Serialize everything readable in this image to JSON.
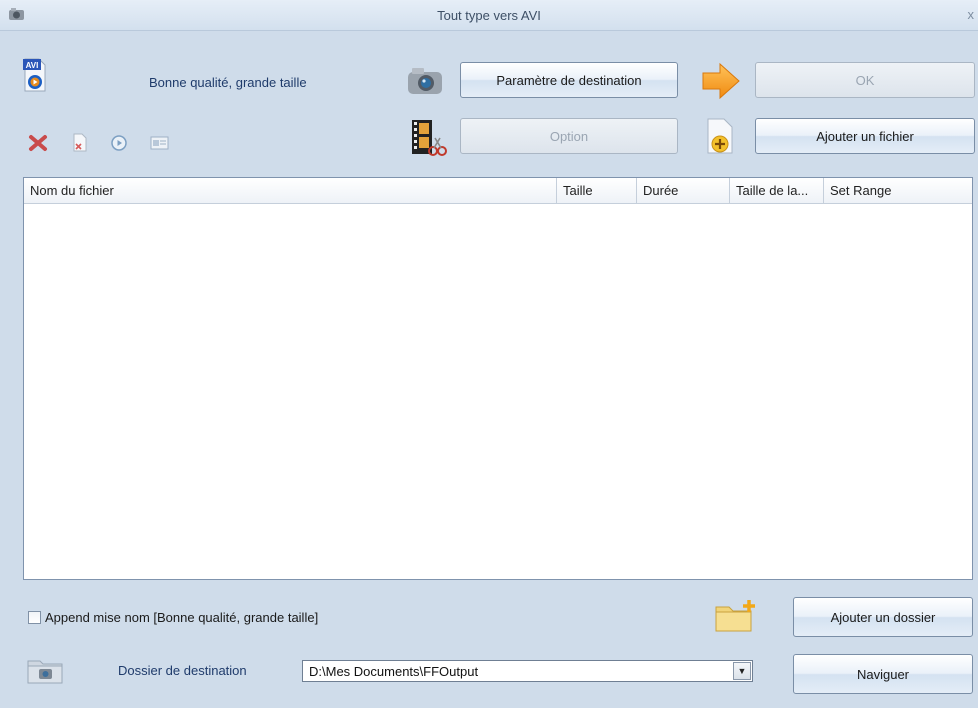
{
  "window": {
    "title": "Tout type vers AVI",
    "close_glyph": "x"
  },
  "profile": {
    "icon": "avi-file-icon",
    "icon_text": "AVI",
    "label": "Bonne qualité, grande taille"
  },
  "toolbar": {
    "settings_icon": "camera-settings-icon",
    "destination_settings_label": "Paramètre de destination",
    "arrow_icon": "right-arrow-icon",
    "ok_label": "OK",
    "clip_icon": "film-scissors-icon",
    "option_label": "Option",
    "add_icon": "add-file-icon",
    "add_file_label": "Ajouter un fichier",
    "mini_icons": [
      "delete-icon",
      "remove-file-icon",
      "play-icon",
      "info-icon"
    ]
  },
  "file_list": {
    "columns": [
      "Nom du fichier",
      "Taille",
      "Durée",
      "Taille de la...",
      "Set Range"
    ],
    "rows": []
  },
  "footer": {
    "append_checkbox_label": "Append mise nom [Bonne qualité, grande taille]",
    "append_checked": false,
    "add_folder_label": "Ajouter un dossier",
    "destination_label": "Dossier de destination",
    "destination_path": "D:\\Mes Documents\\FFOutput",
    "browse_label": "Naviguer"
  },
  "colors": {
    "window_bg": "#cfdcea",
    "accent_label": "#1f3b6b",
    "arrow_orange": "#f5a020"
  }
}
